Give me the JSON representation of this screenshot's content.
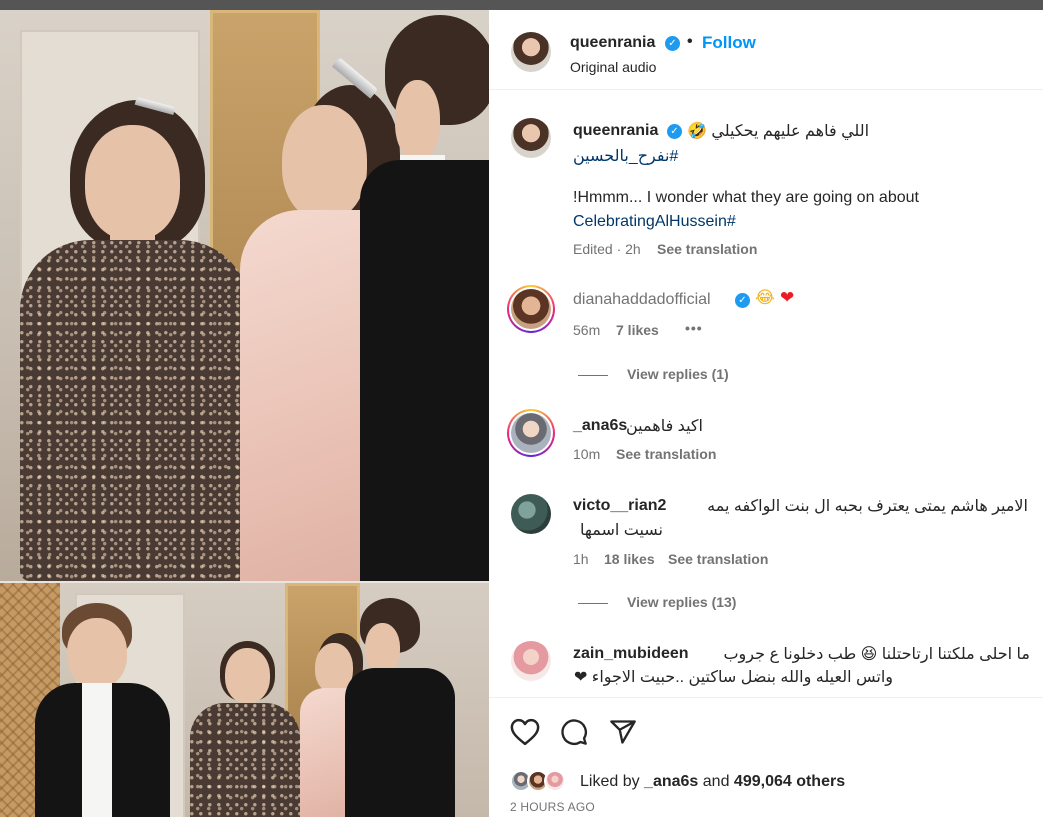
{
  "post": {
    "username": "queenrania",
    "follow_label": "Follow",
    "separator": "•",
    "audio": "Original audio",
    "caption_ar": "اللي فاهم عليهم يحكيلي 🤣",
    "caption_hashtag_ar": "#نفرح_بالحسين",
    "caption_en": "!Hmmm... I wonder what they are going on about",
    "caption_hashtag_en": "CelebratingAlHussein#",
    "caption_meta": "Edited · 2h",
    "see_translation": "See translation"
  },
  "comments": [
    {
      "username": "dianahaddadofficial",
      "verified": true,
      "emoji_laugh": "😂",
      "emoji_heart": "❤",
      "time": "56m",
      "likes": "7 likes",
      "more": "•••",
      "view_replies": "View replies (1)"
    },
    {
      "username": "_ana6s",
      "text": "اكيد فاهمين",
      "time": "10m",
      "see_translation": "See translation"
    },
    {
      "username": "victo__rian2",
      "text_line1": "الامير هاشم يمتى يعترف بحبه ال بنت الواكفه يمه",
      "text_line2": "نسيت اسمها",
      "time": "1h",
      "likes": "18 likes",
      "see_translation": "See translation",
      "view_replies": "View replies (13)"
    },
    {
      "username": "zain_mubideen",
      "text_line1": "ما احلى ملكتنا ارتاحتلنا 😆 طب دخلونا ع جروب",
      "text_line2": "واتس العيله والله بنضل ساكتين ..حبيت الاجواء ❤"
    }
  ],
  "actions": {
    "like_icon": "heart-outline-icon",
    "comment_icon": "comment-bubble-icon",
    "share_icon": "paper-plane-icon"
  },
  "likes": {
    "prefix": "Liked by",
    "user": "_ana6s",
    "middle": "and",
    "count": "499,064 others"
  },
  "timestamp": "2 HOURS AGO",
  "colors": {
    "link_blue": "#0095f6",
    "hashtag": "#00376b",
    "muted": "#737373",
    "verified": "#1d9bf0"
  }
}
